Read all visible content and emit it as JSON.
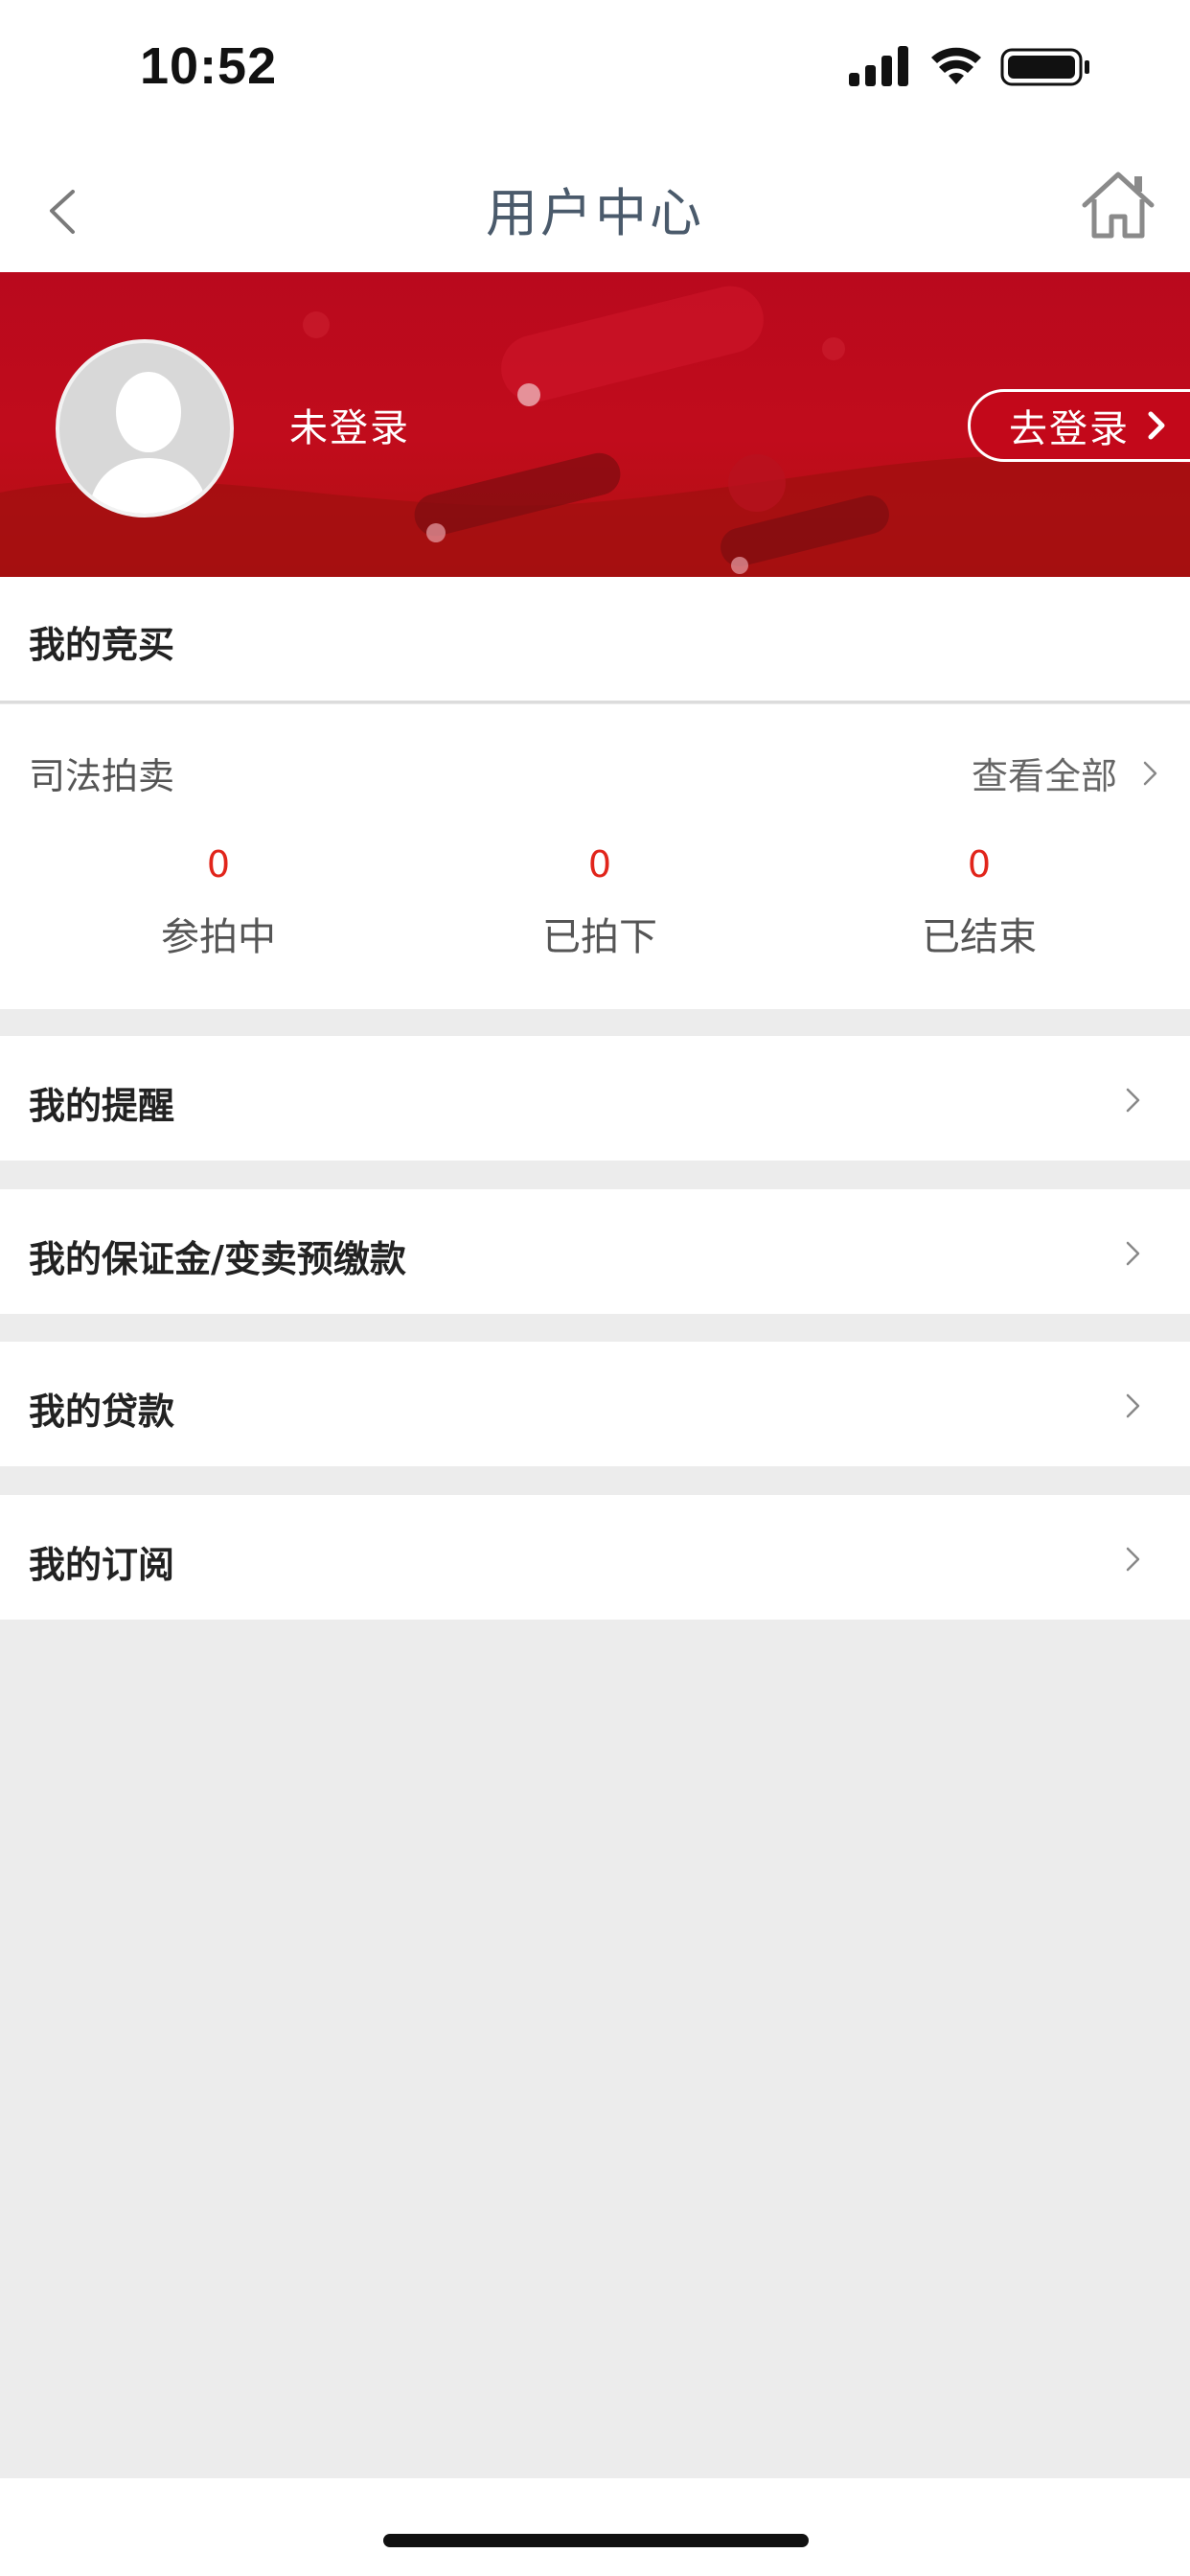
{
  "status_bar": {
    "time": "10:52"
  },
  "nav": {
    "title": "用户中心",
    "back_icon": "chevron-left-icon",
    "home_icon": "home-icon"
  },
  "banner": {
    "login_status": "未登录",
    "login_button": "去登录"
  },
  "auction": {
    "title": "我的竞买",
    "subtitle": "司法拍卖",
    "view_all": "查看全部",
    "stats": [
      {
        "value": "0",
        "label": "参拍中"
      },
      {
        "value": "0",
        "label": "已拍下"
      },
      {
        "value": "0",
        "label": "已结束"
      }
    ]
  },
  "menu": [
    {
      "label": "我的提醒"
    },
    {
      "label": "我的保证金/变卖预缴款"
    },
    {
      "label": "我的贷款"
    },
    {
      "label": "我的订阅"
    }
  ],
  "colors": {
    "accent_red": "#c10c1c",
    "stat_red": "#e1251b",
    "background": "#ececec"
  }
}
